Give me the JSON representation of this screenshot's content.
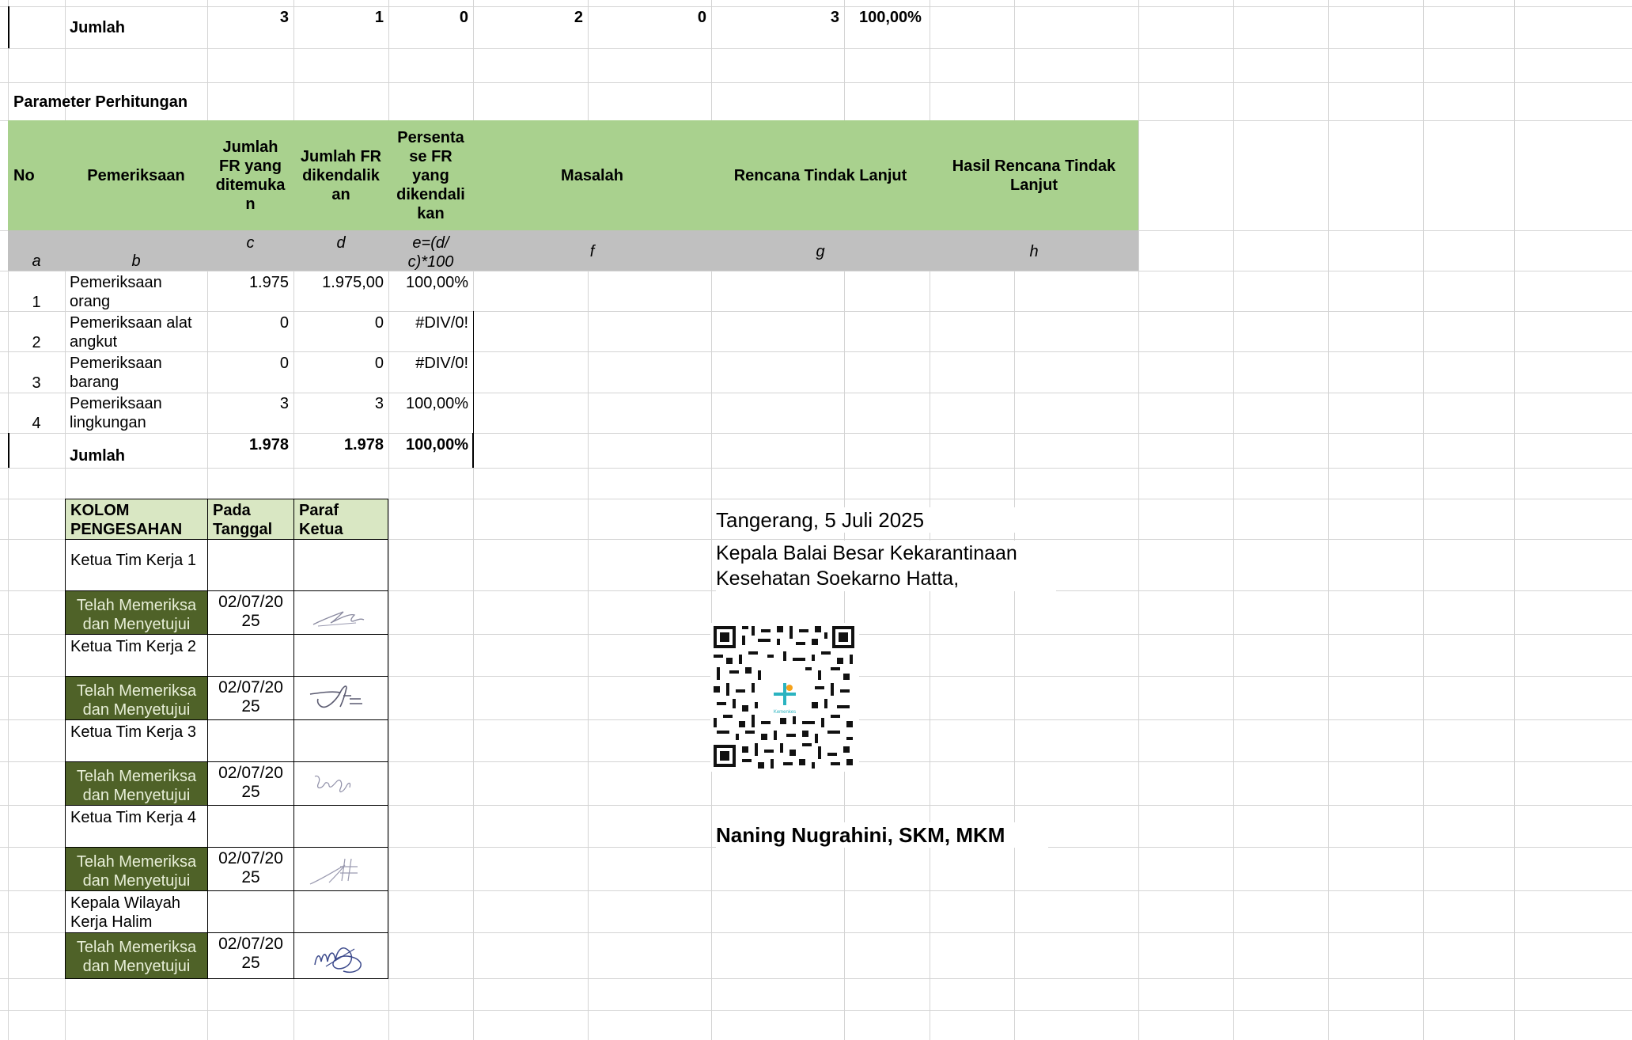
{
  "top_total": {
    "label": "Jumlah",
    "values": [
      "3",
      "1",
      "0",
      "2",
      "0",
      "3",
      "100,00%"
    ]
  },
  "param": {
    "title": "Parameter Perhitungan",
    "headers": {
      "no": "No",
      "pemeriksaan": "Pemeriksaan",
      "jumlah_ditemukan": "Jumlah FR yang ditemuka n",
      "jumlah_dikendalikan": "Jumlah FR dikendalik an",
      "persentase": "Persenta se FR yang dikendali kan",
      "masalah": "Masalah",
      "rencana": "Rencana Tindak Lanjut",
      "hasil": "Hasil Rencana Tindak Lanjut"
    },
    "letters": [
      "a",
      "b",
      "c",
      "d",
      "e=(d/ c)*100",
      "f",
      "g",
      "h"
    ],
    "rows": [
      {
        "no": "1",
        "name": "Pemeriksaan orang",
        "c": "1.975",
        "d": "1.975,00",
        "e": "100,00%"
      },
      {
        "no": "2",
        "name": "Pemeriksaan alat angkut",
        "c": "0",
        "d": "0",
        "e": "#DIV/0!"
      },
      {
        "no": "3",
        "name": "Pemeriksaan barang",
        "c": "0",
        "d": "0",
        "e": "#DIV/0!"
      },
      {
        "no": "4",
        "name": "Pemeriksaan lingkungan",
        "c": "3",
        "d": "3",
        "e": "100,00%"
      }
    ],
    "total": {
      "label": "Jumlah",
      "c": "1.978",
      "d": "1.978",
      "e": "100,00%"
    }
  },
  "pengesahan": {
    "headers": [
      "KOLOM PENGESAHAN",
      "Pada Tanggal",
      "Paraf Ketua"
    ],
    "entries": [
      {
        "role": "Ketua Tim Kerja 1",
        "status": "Telah Memeriksa dan Menyetujui",
        "date": "02/07/20 25"
      },
      {
        "role": "Ketua Tim Kerja 2",
        "status": "Telah Memeriksa dan Menyetujui",
        "date": "02/07/20 25"
      },
      {
        "role": "Ketua Tim Kerja 3",
        "status": "Telah Memeriksa dan Menyetujui",
        "date": "02/07/20 25"
      },
      {
        "role": "Ketua Tim Kerja 4",
        "status": "Telah Memeriksa dan Menyetujui",
        "date": "02/07/20 25"
      },
      {
        "role": "Kepala Wilayah Kerja Halim",
        "status": "Telah Memeriksa dan Menyetujui",
        "date": "02/07/20 25"
      }
    ]
  },
  "signature": {
    "place_date": "Tangerang, 5 Juli 2025",
    "position_line1": "Kepala Balai Besar Kekarantinaan",
    "position_line2": "Kesehatan Soekarno Hatta,",
    "qr_logo_text": "Kemenkes",
    "name": "Naning Nugrahini, SKM, MKM"
  }
}
